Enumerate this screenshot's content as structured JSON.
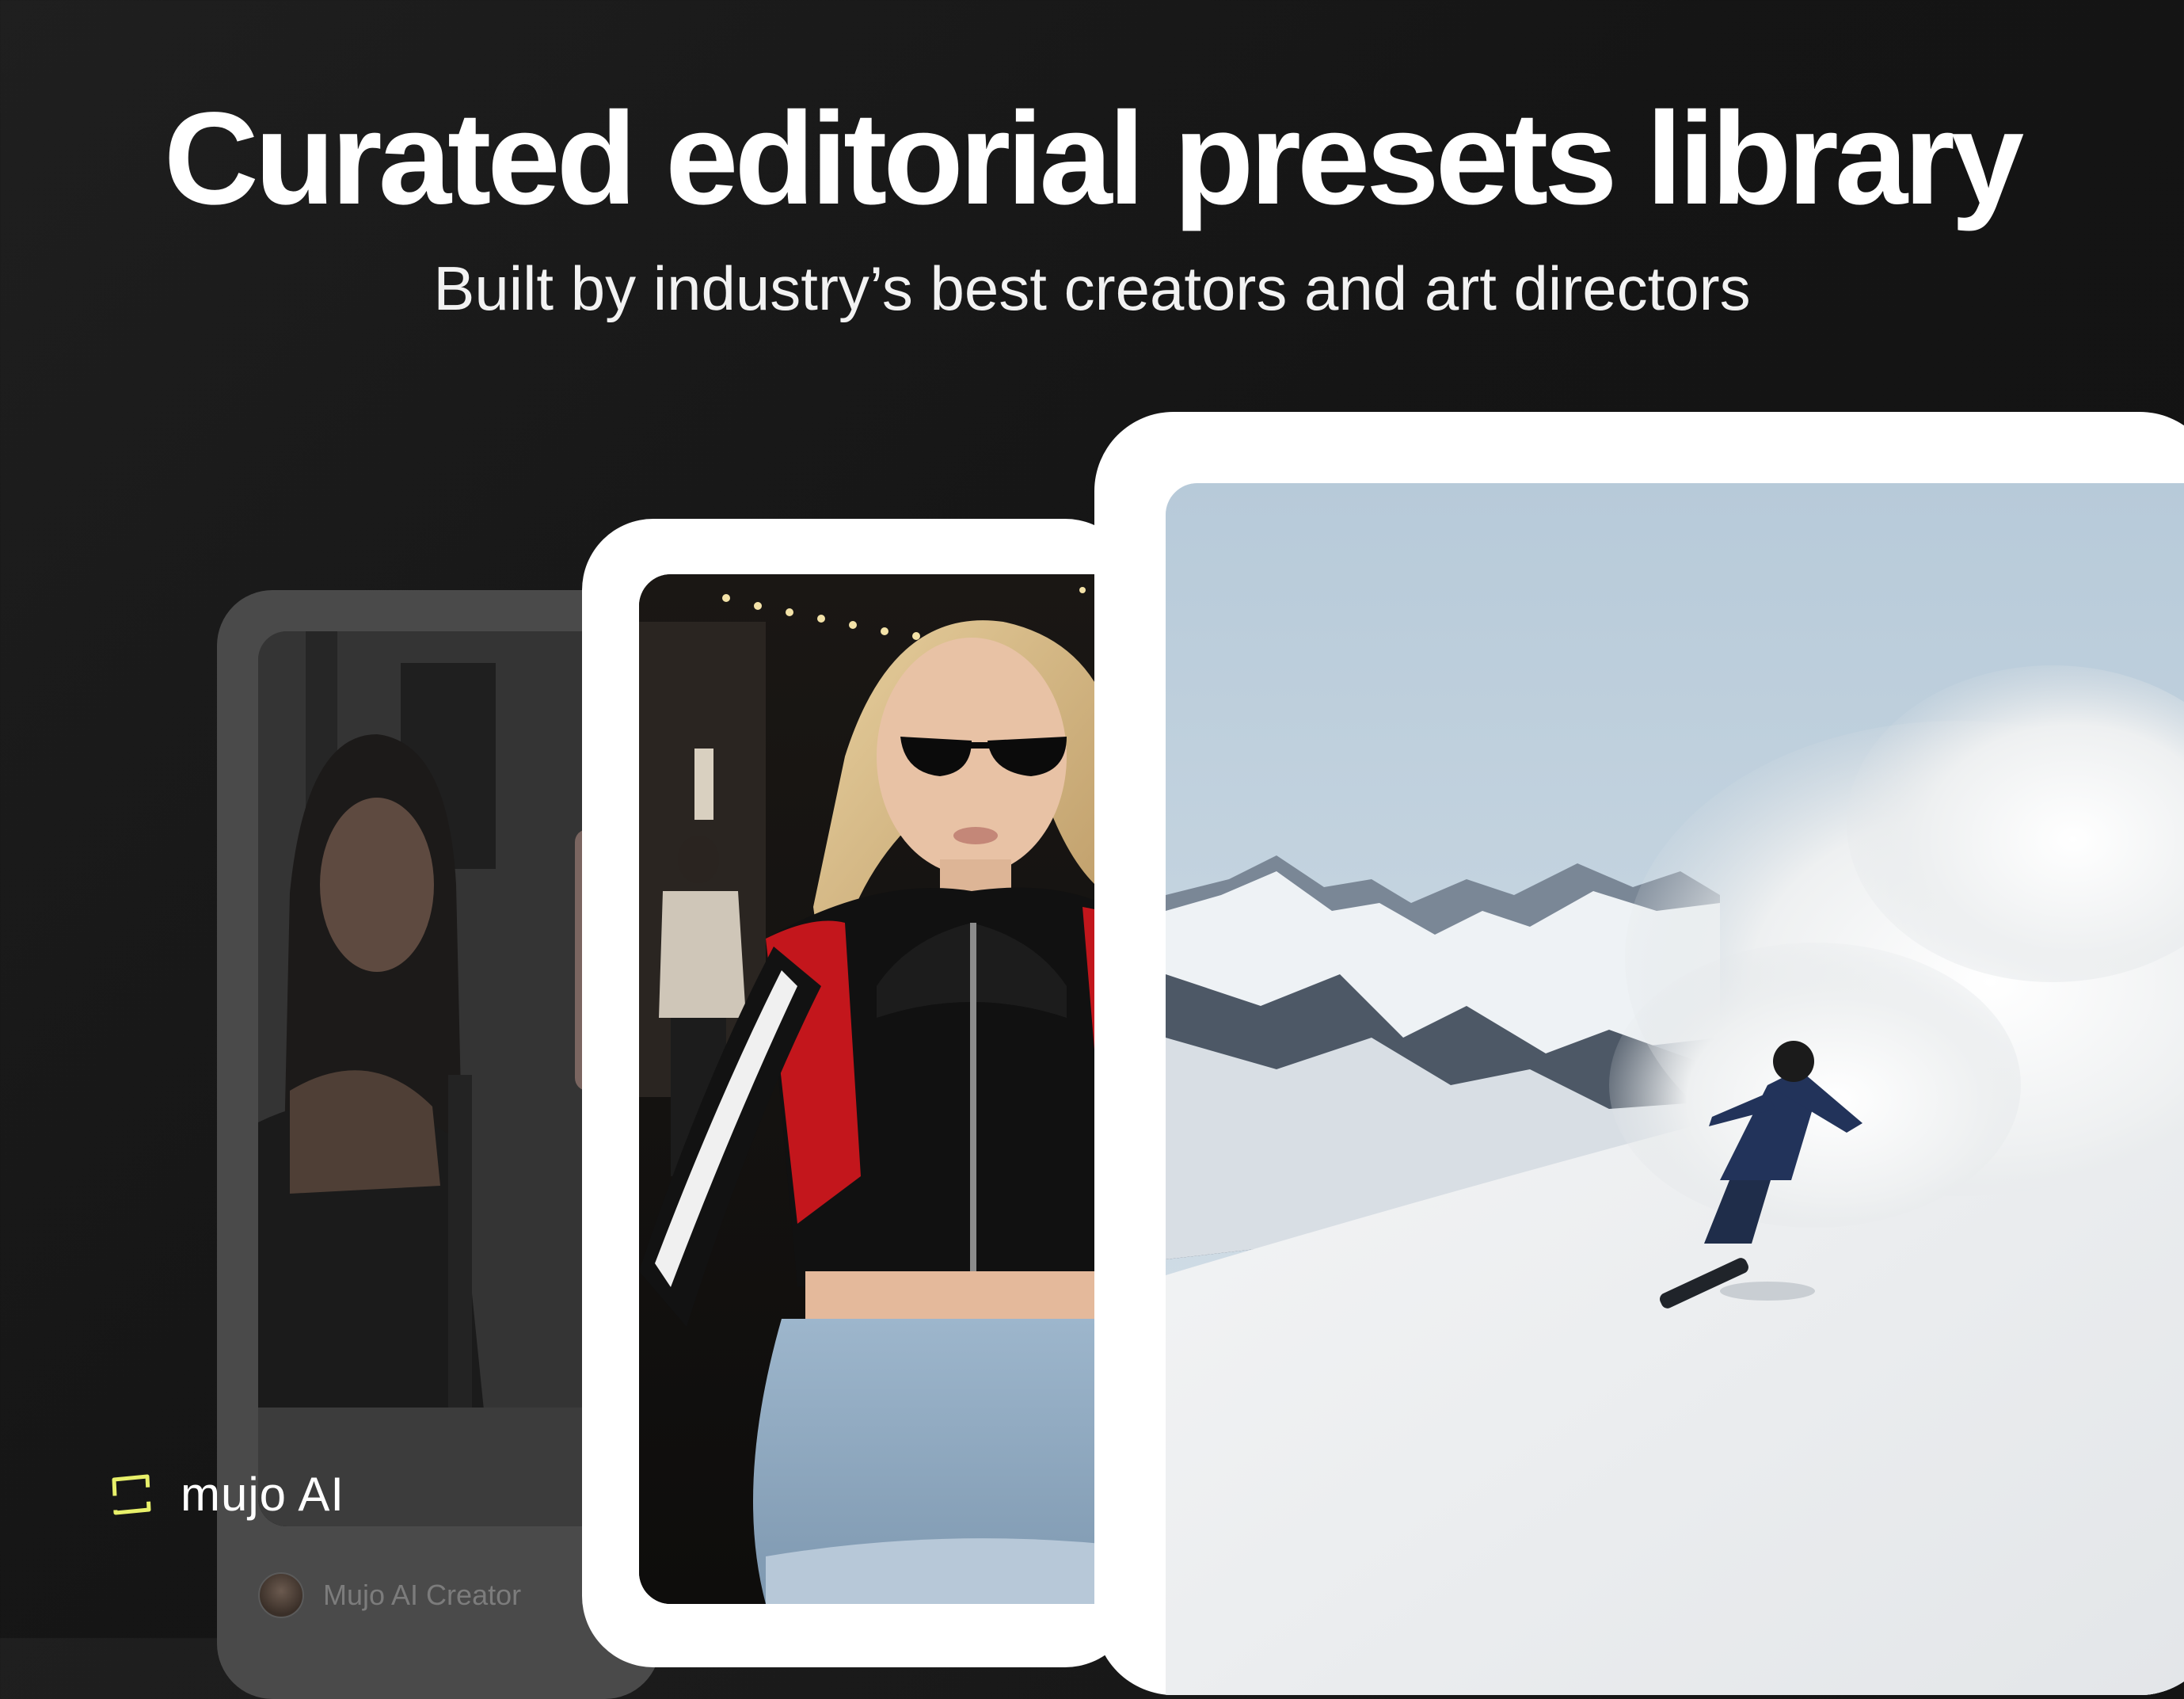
{
  "header": {
    "title": "Curated editorial presets library",
    "subtitle": "Built by industry’s best creators and art directors"
  },
  "cards": [
    {
      "photo_icon": "woman-mirror-selfie-photo",
      "creator": {
        "avatar_icon": "creator-avatar",
        "name": "Mujo AI Creator"
      }
    },
    {
      "photo_icon": "woman-leather-jacket-street-photo"
    },
    {
      "photo_icon": "snowboarder-powder-mountain-photo"
    }
  ],
  "brand": {
    "logo_icon": "mujo-logo-mark",
    "name": "mujo AI",
    "accent_color": "#e8f06a"
  },
  "colors": {
    "background": "#161616",
    "card": "#ffffff",
    "card_dimmed": "#4a4a4a"
  }
}
